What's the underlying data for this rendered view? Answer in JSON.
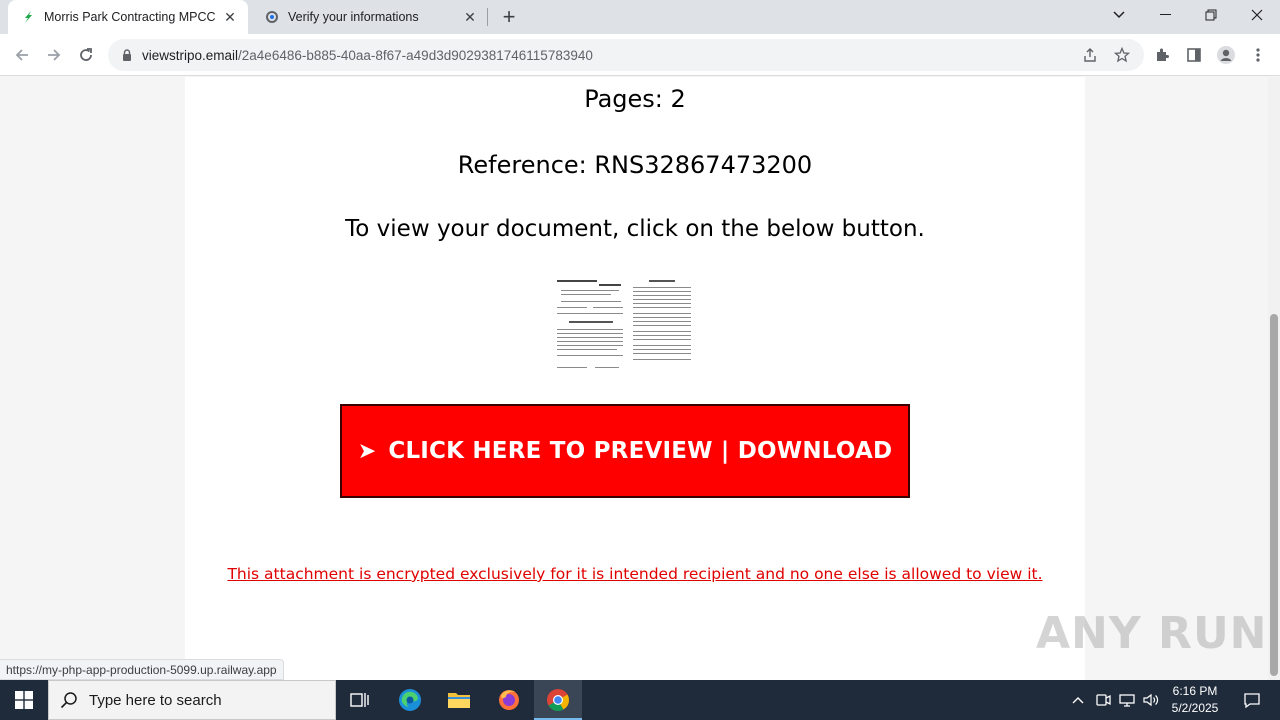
{
  "browser": {
    "tabs": [
      {
        "title": "Morris Park Contracting MPCC",
        "icon": "leaf-favicon",
        "active": true
      },
      {
        "title": "Verify your informations",
        "icon": "loading-favicon",
        "active": false
      }
    ],
    "url_host": "viewstripo.email",
    "url_path": "/2a4e6486-b885-40aa-8f67-a49d3d9029381746115783940",
    "status_url": "https://my-php-app-production-5099.up.railway.app"
  },
  "page": {
    "pages_text": "Pages: 2",
    "reference_text": "Reference: RNS32867473200",
    "instruction_text": "To view your document, click on the below button.",
    "cta_arrow": "➤",
    "cta_label": "CLICK HERE TO PREVIEW | DOWNLOAD",
    "notice_text": "This attachment is encrypted exclusively for it is intended recipient and no one else is allowed to view it."
  },
  "watermark": "ANY RUN",
  "taskbar": {
    "search_placeholder": "Type here to search",
    "time": "6:16 PM",
    "date": "5/2/2025"
  },
  "colors": {
    "cta_background": "#ff0000",
    "notice_text": "#e00000",
    "taskbar": "#1f2a3a"
  }
}
